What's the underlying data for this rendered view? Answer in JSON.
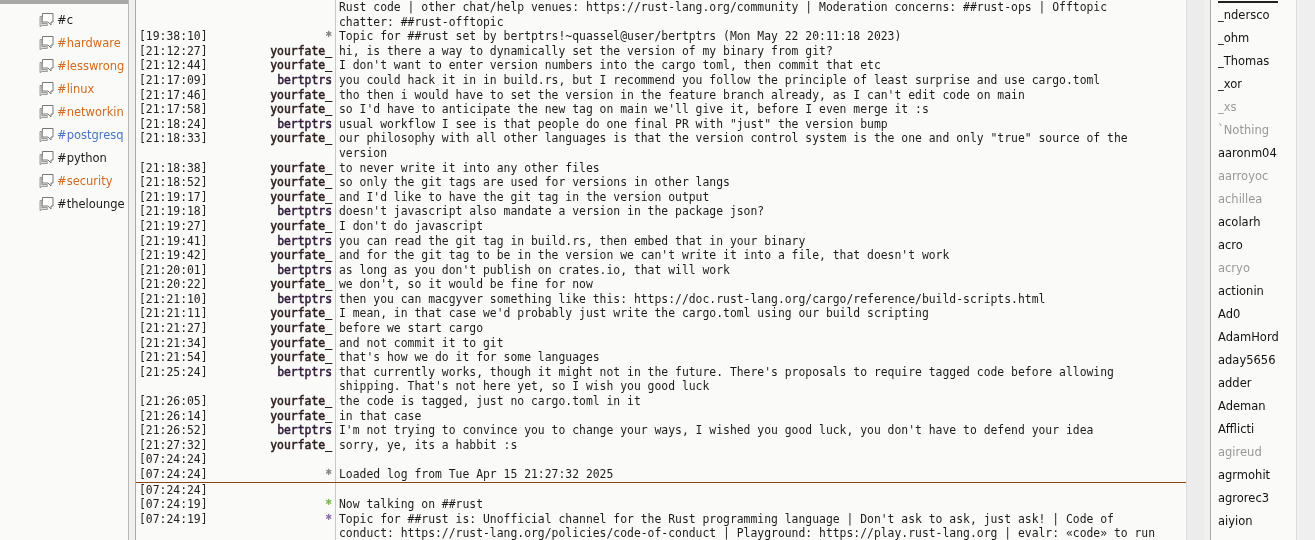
{
  "channels": [
    {
      "name": "#c",
      "color": "#202020"
    },
    {
      "name": "#hardware",
      "color": "#d2691e"
    },
    {
      "name": "#lesswrong",
      "color": "#d2691e"
    },
    {
      "name": "#linux",
      "color": "#d2691e"
    },
    {
      "name": "#networkin",
      "color": "#d2691e"
    },
    {
      "name": "#postgresq",
      "color": "#4a73c4"
    },
    {
      "name": "#python",
      "color": "#202020"
    },
    {
      "name": "#security",
      "color": "#d2691e"
    },
    {
      "name": "#thelounge",
      "color": "#202020"
    }
  ],
  "messages": [
    {
      "kind": "message",
      "text": "Rust code | other chat/help venues: https://rust-lang.org/community | Moderation concerns: ##rust-ops | Offtopic chatter: ##rust-offtopic"
    },
    {
      "kind": "message",
      "time": "[19:38:10]",
      "nick": "*",
      "color": "#808080",
      "text": "Topic for ##rust set by bertptrs!~quassel@user/bertptrs (Mon May 22 20:11:18 2023)"
    },
    {
      "kind": "message",
      "time": "[21:12:27]",
      "nick": "yourfate_",
      "color": "#2a1c1c",
      "text": "hi, is there a way to dynamically set the version of my binary from git?"
    },
    {
      "kind": "message",
      "time": "[21:12:44]",
      "nick": "yourfate_",
      "color": "#2a1c1c",
      "text": "I don't want to enter version numbers into the cargo toml, then commit that etc"
    },
    {
      "kind": "message",
      "time": "[21:17:09]",
      "nick": "bertptrs",
      "color": "#2e1a38",
      "text": "you could hack it in in build.rs, but I recommend you follow the principle of least surprise and use cargo.toml"
    },
    {
      "kind": "message",
      "time": "[21:17:46]",
      "nick": "yourfate_",
      "color": "#2a1c1c",
      "text": "tho then i would have to set the version in the feature branch already, as I can't edit code on main"
    },
    {
      "kind": "message",
      "time": "[21:17:58]",
      "nick": "yourfate_",
      "color": "#2a1c1c",
      "text": "so I'd have to anticipate the new tag on main we'll give it, before I even merge it :s"
    },
    {
      "kind": "message",
      "time": "[21:18:24]",
      "nick": "bertptrs",
      "color": "#2e1a38",
      "text": "usual workflow I see is that people do one final PR with \"just\" the version bump"
    },
    {
      "kind": "message",
      "time": "[21:18:33]",
      "nick": "yourfate_",
      "color": "#2a1c1c",
      "text": "our philosophy with all other languages is that the version control system is the one and only \"true\" source of the version"
    },
    {
      "kind": "message",
      "time": "[21:18:38]",
      "nick": "yourfate_",
      "color": "#2a1c1c",
      "text": "to never write it into any other files"
    },
    {
      "kind": "message",
      "time": "[21:18:52]",
      "nick": "yourfate_",
      "color": "#2a1c1c",
      "text": "so only the git tags are used for versions in other langs"
    },
    {
      "kind": "message",
      "time": "[21:19:17]",
      "nick": "yourfate_",
      "color": "#2a1c1c",
      "text": "and I'd like to have the git tag in the version output"
    },
    {
      "kind": "message",
      "time": "[21:19:18]",
      "nick": "bertptrs",
      "color": "#2e1a38",
      "text": "doesn't javascript also mandate a version in the package json?"
    },
    {
      "kind": "message",
      "time": "[21:19:27]",
      "nick": "yourfate_",
      "color": "#2a1c1c",
      "text": "I don't do javascript"
    },
    {
      "kind": "message",
      "time": "[21:19:41]",
      "nick": "bertptrs",
      "color": "#2e1a38",
      "text": "you can read the git tag in build.rs, then embed that in your binary"
    },
    {
      "kind": "message",
      "time": "[21:19:42]",
      "nick": "yourfate_",
      "color": "#2a1c1c",
      "text": "and for the git tag to be in the version we can't write it into a file, that doesn't work"
    },
    {
      "kind": "message",
      "time": "[21:20:01]",
      "nick": "bertptrs",
      "color": "#2e1a38",
      "text": "as long as you don't publish on crates.io, that will work"
    },
    {
      "kind": "message",
      "time": "[21:20:22]",
      "nick": "yourfate_",
      "color": "#2a1c1c",
      "text": "we don't, so it would be fine for now"
    },
    {
      "kind": "message",
      "time": "[21:21:10]",
      "nick": "bertptrs",
      "color": "#2e1a38",
      "text": "then you can macgyver something like this: https://doc.rust-lang.org/cargo/reference/build-scripts.html"
    },
    {
      "kind": "message",
      "time": "[21:21:11]",
      "nick": "yourfate_",
      "color": "#2a1c1c",
      "text": "I mean, in that case we'd probably just write the cargo.toml using our build scripting"
    },
    {
      "kind": "message",
      "time": "[21:21:27]",
      "nick": "yourfate_",
      "color": "#2a1c1c",
      "text": "before we start cargo"
    },
    {
      "kind": "message",
      "time": "[21:21:34]",
      "nick": "yourfate_",
      "color": "#2a1c1c",
      "text": "and not commit it to git"
    },
    {
      "kind": "message",
      "time": "[21:21:54]",
      "nick": "yourfate_",
      "color": "#2a1c1c",
      "text": "that's how we do it for some languages"
    },
    {
      "kind": "message",
      "time": "[21:25:24]",
      "nick": "bertptrs",
      "color": "#2e1a38",
      "text": "that currently works, though it might not in the future. There's proposals to require tagged code before allowing shipping. That's not here yet, so I wish you good luck"
    },
    {
      "kind": "message",
      "time": "[21:26:05]",
      "nick": "yourfate_",
      "color": "#2a1c1c",
      "text": "the code is tagged, just no cargo.toml in it"
    },
    {
      "kind": "message",
      "time": "[21:26:14]",
      "nick": "yourfate_",
      "color": "#2a1c1c",
      "text": "in that case"
    },
    {
      "kind": "message",
      "time": "[21:26:52]",
      "nick": "bertptrs",
      "color": "#2e1a38",
      "text": "I'm not trying to convince you to change your ways, I wished you good luck, you don't have to defend your idea"
    },
    {
      "kind": "message",
      "time": "[21:27:32]",
      "nick": "yourfate_",
      "color": "#2a1c1c",
      "text": "sorry, ye, its a habbit :s"
    },
    {
      "kind": "message",
      "time": "[07:24:24]"
    },
    {
      "kind": "message",
      "time": "[07:24:24]",
      "nick": "*",
      "color": "#808080",
      "text": "Loaded log from Tue Apr 15 21:27:32 2025"
    },
    {
      "kind": "marker"
    },
    {
      "kind": "message",
      "time": "[07:24:24]"
    },
    {
      "kind": "message",
      "time": "[07:24:19]",
      "nick": "*",
      "color": "#7ab648",
      "text": "Now talking on ##rust"
    },
    {
      "kind": "message",
      "time": "[07:24:19]",
      "nick": "*",
      "color": "#8a6aa8",
      "text": "Topic for ##rust is: Unofficial channel for the Rust programming language | Don't ask to ask, just ask! | Code of conduct: https://rust-lang.org/policies/code-of-conduct | Playground: https://play.rust-lang.org | evalr: «code» to run"
    }
  ],
  "nicks": [
    {
      "name": "_ndersco",
      "away": false
    },
    {
      "name": "_ohm",
      "away": false
    },
    {
      "name": "_Thomas",
      "away": false
    },
    {
      "name": "_xor",
      "away": false
    },
    {
      "name": "_xs",
      "away": true
    },
    {
      "name": "`Nothing",
      "away": true
    },
    {
      "name": "aaronm04",
      "away": false
    },
    {
      "name": "aarroyoc",
      "away": true
    },
    {
      "name": "achillea",
      "away": true
    },
    {
      "name": "acolarh",
      "away": false
    },
    {
      "name": "acro",
      "away": false
    },
    {
      "name": "acryo",
      "away": true
    },
    {
      "name": "actionin",
      "away": false
    },
    {
      "name": "Ad0",
      "away": false
    },
    {
      "name": "AdamHord",
      "away": false
    },
    {
      "name": "aday5656",
      "away": false
    },
    {
      "name": "adder",
      "away": false
    },
    {
      "name": "Ademan",
      "away": false
    },
    {
      "name": "Afflicti",
      "away": false
    },
    {
      "name": "agireud",
      "away": true
    },
    {
      "name": "agrmohit",
      "away": false
    },
    {
      "name": "agrorec3",
      "away": false
    },
    {
      "name": "aiyion",
      "away": false
    }
  ]
}
